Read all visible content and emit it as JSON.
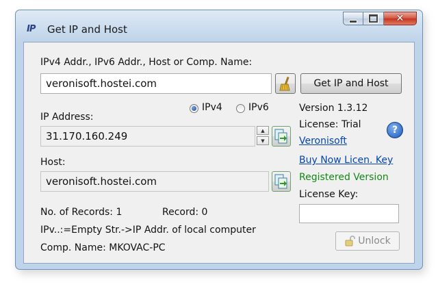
{
  "window": {
    "app_icon": "IP",
    "title": "Get IP and Host"
  },
  "query": {
    "label": "IPv4 Addr., IPv6 Addr., Host or Comp. Name:",
    "value": "veronisoft.hostei.com",
    "clear_icon": "broom-icon",
    "button": "Get IP and Host"
  },
  "ip": {
    "label": "IP Address:",
    "value": "31.170.160.249",
    "radio_ipv4": "IPv4",
    "radio_ipv6": "IPv6",
    "selected": "IPv4"
  },
  "host": {
    "label": "Host:",
    "value": "veronisoft.hostei.com"
  },
  "status": {
    "records_label": "No. of Records: 1",
    "record_label": "Record: 0",
    "hint": "IPv..:=Empty Str.->IP Addr. of local computer",
    "comp_name": "Comp. Name:  MKOVAC-PC"
  },
  "about": {
    "version": "Version 1.3.12",
    "license": "License: Trial",
    "vendor_link": "Veronisoft",
    "buy_link": "Buy Now Licen. Key",
    "registered": "Registered Version",
    "license_key_label": "License Key:",
    "license_key_value": "",
    "unlock_button": "Unlock"
  }
}
